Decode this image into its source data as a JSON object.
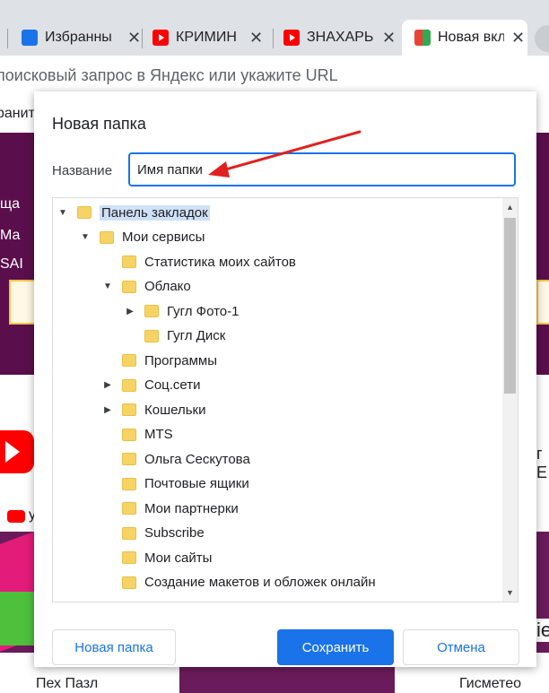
{
  "tabs": [
    {
      "title": "Избранны",
      "icon": "monitor-icon"
    },
    {
      "title": "КРИМИН",
      "icon": "youtube-icon"
    },
    {
      "title": "ЗНАХАРЬ",
      "icon": "youtube-icon"
    },
    {
      "title": "Новая вкл",
      "icon": "yandex-tiles-icon",
      "active": true
    }
  ],
  "address_bar": {
    "placeholder": "поисковый запрос в Яндекс или укажите URL"
  },
  "bookmarks_bar": {
    "fragment": "ранит"
  },
  "background": {
    "left_labels": [
      "ща",
      "Ма",
      "SAI"
    ],
    "yt_letter": "у",
    "bottom_left": "Пех Пазл",
    "bottom_right": "Гисметео",
    "right_fragment": "г Е",
    "right_fragment2": "ie"
  },
  "dialog": {
    "title": "Новая папка",
    "name_label": "Название",
    "name_value": "Имя папки",
    "tree": [
      {
        "label": "Панель закладок",
        "level": 0,
        "expander": "down",
        "selected": true
      },
      {
        "label": "Мои сервисы",
        "level": 1,
        "expander": "down"
      },
      {
        "label": "Статистика моих сайтов",
        "level": 2,
        "expander": "none"
      },
      {
        "label": "Облако",
        "level": 2,
        "expander": "down"
      },
      {
        "label": "Гугл Фото-1",
        "level": 3,
        "expander": "right"
      },
      {
        "label": "Гугл Диск",
        "level": 3,
        "expander": "none"
      },
      {
        "label": "Программы",
        "level": 2,
        "expander": "none"
      },
      {
        "label": "Соц.сети",
        "level": 2,
        "expander": "right"
      },
      {
        "label": "Кошельки",
        "level": 2,
        "expander": "right"
      },
      {
        "label": "MTS",
        "level": 2,
        "expander": "none"
      },
      {
        "label": "Ольга Сескутова",
        "level": 2,
        "expander": "none"
      },
      {
        "label": "Почтовые ящики",
        "level": 2,
        "expander": "none"
      },
      {
        "label": "Мои партнерки",
        "level": 2,
        "expander": "none"
      },
      {
        "label": "Subscribe",
        "level": 2,
        "expander": "none"
      },
      {
        "label": "Мои сайты",
        "level": 2,
        "expander": "none"
      },
      {
        "label": "Создание макетов и обложек онлайн",
        "level": 2,
        "expander": "none"
      }
    ],
    "buttons": {
      "new_folder": "Новая папка",
      "save": "Сохранить",
      "cancel": "Отмена"
    }
  },
  "colors": {
    "accent": "#1a73e8",
    "annotation_arrow": "#e02020",
    "folder": "#f6d365",
    "page_bg": "#5a0f4c"
  }
}
